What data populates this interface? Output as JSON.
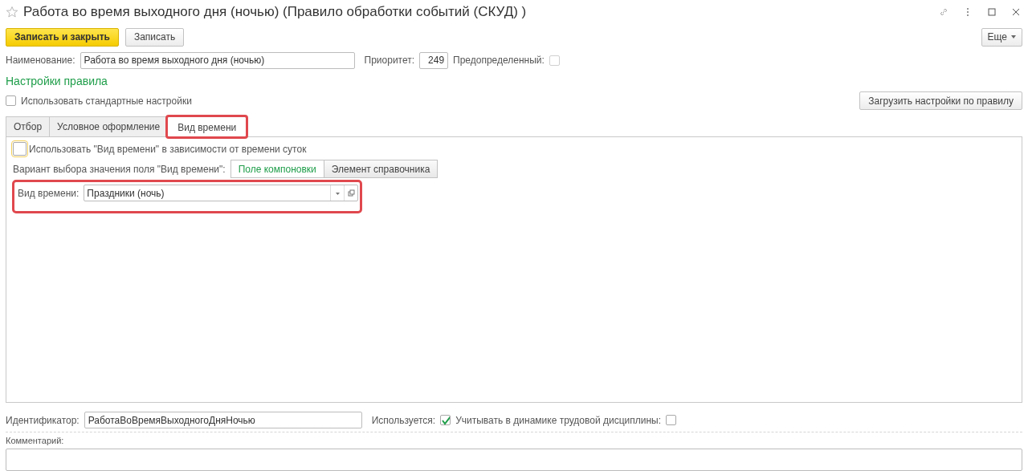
{
  "window": {
    "title": "Работа во время выходного дня (ночью) (Правило обработки событий (СКУД) )",
    "favorite": false
  },
  "toolbar": {
    "buttons": [
      {
        "label": "Записать и закрыть",
        "kind": "primary"
      },
      {
        "label": "Записать",
        "kind": "normal"
      }
    ],
    "more": "Еще"
  },
  "header": {
    "name_label": "Наименование:",
    "name_value": "Работа во время выходного дня (ночью)",
    "priority_label": "Приоритет:",
    "priority_value": "249",
    "predefined_label": "Предопределенный:",
    "predefined_checked": false
  },
  "settings": {
    "title": "Настройки правила",
    "use_standard_label": "Использовать стандартные настройки",
    "use_standard_checked": false,
    "load_button": "Загрузить настройки по правилу"
  },
  "tabs": [
    {
      "label": "Отбор",
      "selected": false,
      "highlighted": false
    },
    {
      "label": "Условное оформление",
      "selected": false,
      "highlighted": false
    },
    {
      "label": "Вид времени",
      "selected": true,
      "highlighted": true
    }
  ],
  "tab_content": {
    "depend_label": "Использовать \"Вид времени\" в зависимости от времени суток",
    "depend_checked": false,
    "variant_label": "Вариант выбора значения поля \"Вид времени\":",
    "variants": [
      {
        "label": "Поле компоновки",
        "selected": true
      },
      {
        "label": "Элемент справочника",
        "selected": false
      }
    ],
    "time_kind_label": "Вид времени:",
    "time_kind_value": "Праздники (ночь)",
    "time_kind_highlighted": true
  },
  "footer": {
    "id_label": "Идентификатор:",
    "id_value": "РаботаВоВремяВыходногоДняНочью",
    "used_label": "Используется:",
    "used_checked": true,
    "discipline_label": "Учитывать в динамике трудовой дисциплины:",
    "discipline_checked": false,
    "comment_label": "Комментарий:"
  }
}
